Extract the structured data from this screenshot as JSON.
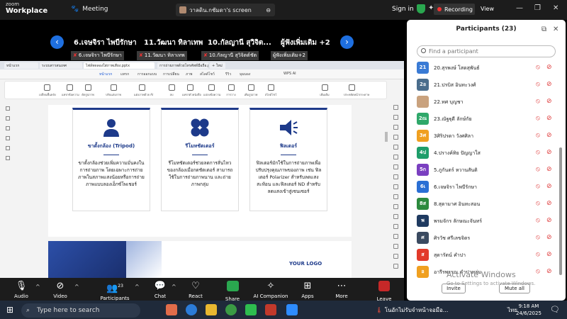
{
  "zoom": {
    "logo_top": "zoom",
    "logo_name": "Workplace",
    "meeting_label": "Meeting",
    "screen_label": "วาลดิน.กชัมดา's screen",
    "signin": "Sign in",
    "recording": "Recording",
    "view": "View"
  },
  "strip": {
    "names": [
      "6.เจษจิรา ไพบีรักษา",
      "11.วัฒนา ทิลาเทพ",
      "10.กัลญานี สุวิจิต...",
      "ผู้ฟังเพิ่มเติม +2"
    ],
    "tags": [
      "6.เจษจิรา ไพบีรักษา",
      "11.วัฒนา ทิลาเทพ",
      "10.กัลญานี สุวิจิตต์ชัต",
      "ผู้ฟังเพิ่มเติม+2"
    ]
  },
  "shared": {
    "browser_tabs": [
      "หน้าแรก",
      "ระบบสารสนเทศ",
      "ไฟล์ทดลองใส่ภาพเสียง.pptx",
      "การถ่ายภาพด้วยโทรศัพท์มือถือ.pptx",
      "+ ใหม่"
    ],
    "ribbon_tabs": [
      "หน้าแรก",
      "แทรก",
      "การออกแบบ",
      "การเปลี่ยน",
      "ภาพ",
      "สไลด์โชว์",
      "รีวิว",
      "มุมมอง",
      "WPS AI"
    ],
    "tools": [
      "เปลี่ยนพื้นหลัง",
      "แทรกข้อความ",
      "ตัดรูปภาพ",
      "ปรับแต่งภาพ",
      "แต่งภาพด้วย AI",
      "ลบ",
      "แทรกตัวหนังสือ",
      "แปลงข้อความ",
      "การวาง",
      "เพิ่มรูปภาพ",
      "สไลด์โชว์",
      "เพิ่มเติม",
      "ประหยัดหน้ากระดาษ"
    ],
    "cards": [
      {
        "title": "ขาตั้งกล้อง (Tripod)",
        "desc": "ขาตั้งกล้องช่วยเพิ่มความมั่นคงในการถ่ายภาพ โดยเฉพาะการถ่ายภาพในสภาพแสงน้อยหรือการถ่ายภาพแบบลองเอ็กซ์โพเชอร์"
      },
      {
        "title": "รีโมทชัตเตอร์",
        "desc": "รีโมทชัตเตอร์ช่วยลดการสั่นไหวของกล้องเมื่อกดชัตเตอร์ สามารถใช้ในการถ่ายภาพนาน และถ่ายภาพกลุ่ม"
      },
      {
        "title": "ฟิลเตอร์",
        "desc": "ฟิลเตอร์มักใช้ในการถ่ายภาพเพื่อปรับปรุงคุณภาพของภาพ เช่น ฟิลเตอร์ Polarizer สำหรับลดแสงสะท้อน และฟิลเตอร์ ND สำหรับลดแสงเข้าสู่เซนเซอร์"
      }
    ],
    "your_logo": "YOUR LOGO"
  },
  "participants": {
    "title": "Participants (23)",
    "search_placeholder": "Find a participant",
    "list": [
      {
        "av": "21",
        "color": "#3a7bd5",
        "name": "20.สุรพงษ์ โสดสุพันธ์"
      },
      {
        "av": "2อ",
        "color": "#4a6d8c",
        "name": "21.ปรบิส อินทะวงศ์"
      },
      {
        "av": "",
        "color": "#c9a27e",
        "name": "22.ทศ บุญชา"
      },
      {
        "av": "2ณ",
        "color": "#2fa86a",
        "name": "23.ณัฐฐุดี ลักษ์กัย"
      },
      {
        "av": "3ศ",
        "color": "#f0a020",
        "name": "3ศิริปรดา วังศศิลา"
      },
      {
        "av": "4ป",
        "color": "#1e9e6a",
        "name": "4.ปรางค์ทิย ปัญญาใส"
      },
      {
        "av": "5ก",
        "color": "#7a3fc0",
        "name": "5.ภูกันตร์ หวานสันติ"
      },
      {
        "av": "6เ",
        "color": "#2a6fd4",
        "name": "6.เจษจิรา ไพบีรักษา"
      },
      {
        "av": "8ส",
        "color": "#2c8a3e",
        "name": "8.สุดามาศ อินทะสอน"
      },
      {
        "av": "พ",
        "color": "#1f3a60",
        "name": "พรมจักร ลักษณะจันทร์"
      },
      {
        "av": "ศ",
        "color": "#3a4a60",
        "name": "ศิรวัช ศรีเลขจิตร"
      },
      {
        "av": "ส",
        "color": "#e23a2a",
        "name": "สุดารัตน์ คำปา"
      },
      {
        "av": "อ",
        "color": "#f0a020",
        "name": "อารีรพรรณ คำปาหลุ่ม"
      }
    ],
    "invite": "Invite",
    "mute_all": "Mute all"
  },
  "watermark": {
    "line1": "Activate Windows",
    "line2": "Go to Settings to activate Windows."
  },
  "controls": {
    "audio": "Audio",
    "video": "Video",
    "participants": "Participants",
    "participants_count": "23",
    "chat": "Chat",
    "react": "React",
    "share": "Share",
    "ai": "AI Companion",
    "apps": "Apps",
    "more": "More",
    "leave": "Leave"
  },
  "taskbar": {
    "search": "Type here to search",
    "note": "โนอักไม่รับจำหน้าจอมือ...",
    "lang": "ไทย",
    "time": "9:18 AM",
    "date": "24/6/2025"
  }
}
